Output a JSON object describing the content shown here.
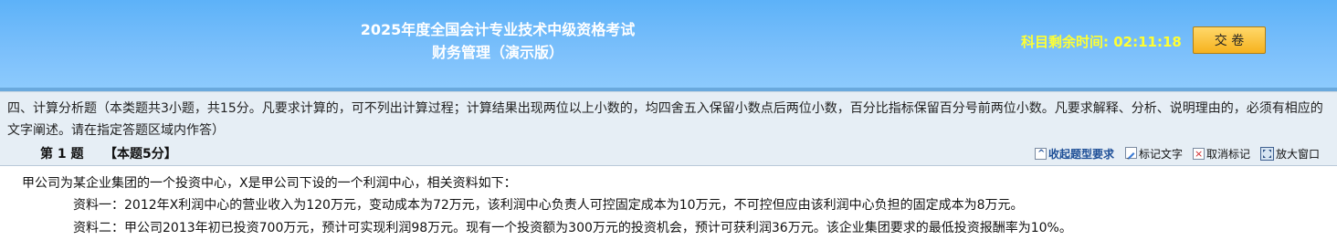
{
  "header": {
    "title_line1": "2025年度全国会计专业技术中级资格考试",
    "title_line2": "财务管理（演示版）",
    "timer_label": "科目剩余时间:",
    "timer_value": "02:11:18",
    "submit_label": "交 卷"
  },
  "instructions": {
    "text": "四、计算分析题（本类题共3小题，共15分。凡要求计算的，可不列出计算过程；计算结果出现两位以上小数的，均四舍五入保留小数点后两位小数，百分比指标保留百分号前两位小数。凡要求解释、分析、说明理由的，必须有相应的文字阐述。请在指定答题区域内作答）"
  },
  "question_bar": {
    "number": "第 1 题",
    "score": "【本题5分】",
    "tools": {
      "collapse_label": "收起题型要求",
      "mark_label": "标记文字",
      "cancel_label": "取消标记",
      "enlarge_label": "放大窗口"
    }
  },
  "question": {
    "intro": "甲公司为某企业集团的一个投资中心，X是甲公司下设的一个利润中心，相关资料如下：",
    "material1": "资料一：2012年X利润中心的营业收入为120万元，变动成本为72万元，该利润中心负责人可控固定成本为10万元，不可控但应由该利润中心负担的固定成本为8万元。",
    "material2": "资料二：甲公司2013年初已投资700万元，预计可实现利润98万元。现有一个投资额为300万元的投资机会，预计可获利润36万元。该企业集团要求的最低投资报酬率为10%。"
  }
}
